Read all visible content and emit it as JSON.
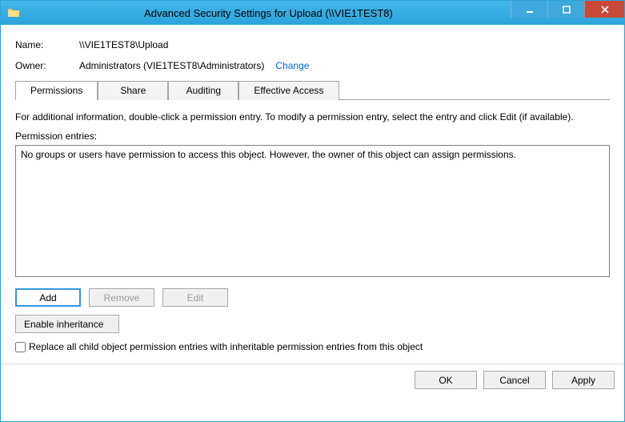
{
  "window": {
    "title": "Advanced Security Settings for Upload (\\\\VIE1TEST8)"
  },
  "fields": {
    "name_label": "Name:",
    "name_value": "\\\\VIE1TEST8\\Upload",
    "owner_label": "Owner:",
    "owner_value": "Administrators (VIE1TEST8\\Administrators)",
    "change_link": "Change"
  },
  "tabs": {
    "permissions": "Permissions",
    "share": "Share",
    "auditing": "Auditing",
    "effective_access": "Effective Access"
  },
  "info_text": "For additional information, double-click a permission entry. To modify a permission entry, select the entry and click Edit (if available).",
  "entries_label": "Permission entries:",
  "entries_empty": "No groups or users have permission to access this object. However, the owner of this object can assign permissions.",
  "buttons": {
    "add": "Add",
    "remove": "Remove",
    "edit": "Edit",
    "enable_inheritance": "Enable inheritance",
    "ok": "OK",
    "cancel": "Cancel",
    "apply": "Apply"
  },
  "checkbox": {
    "replace_label": "Replace all child object permission entries with inheritable permission entries from this object"
  }
}
